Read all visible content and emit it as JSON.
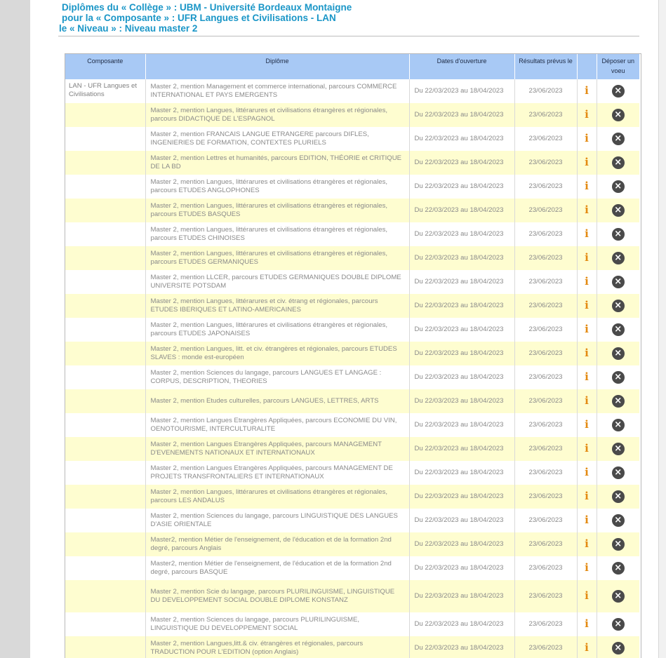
{
  "heading": {
    "line1": "Diplômes du « Collège » : UBM - Université Bordeaux Montaigne",
    "line2": "pour la « Composante » : UFR Langues et Civilisations - LAN",
    "line3": "le « Niveau » : Niveau master 2"
  },
  "table": {
    "headers": {
      "composante": "Composante",
      "diplome": "Diplôme",
      "dates": "Dates d'ouverture",
      "resultats": "Résultats prévus le",
      "info": "",
      "deposer": "Déposer un voeu"
    },
    "composante": "LAN - UFR Langues et Civilisations",
    "info_icon": "info-icon",
    "deposer_icon": "close-circle-icon",
    "rows": [
      {
        "diplome": "Master 2, mention Management et commerce international, parcours COMMERCE INTERNATIONAL ET PAYS EMERGENTS",
        "dates": "Du 22/03/2023 au 18/04/2023",
        "resultats": "23/06/2023"
      },
      {
        "diplome": "Master 2, mention Langues, littérarures et civilisations étrangères et régionales, parcours DIDACTIQUE DE L'ESPAGNOL",
        "dates": "Du 22/03/2023 au 18/04/2023",
        "resultats": "23/06/2023"
      },
      {
        "diplome": "Master 2, mention FRANCAIS LANGUE ETRANGERE parcours DIFLES, INGENIERIES DE FORMATION, CONTEXTES PLURIELS",
        "dates": "Du 22/03/2023 au 18/04/2023",
        "resultats": "23/06/2023"
      },
      {
        "diplome": "Master 2, mention Lettres et humanités, parcours EDITION, THÉORIE et CRITIQUE DE LA BD",
        "dates": "Du 22/03/2023 au 18/04/2023",
        "resultats": "23/06/2023"
      },
      {
        "diplome": "Master 2, mention Langues, littérarures et civilisations étrangères et régionales, parcours ETUDES ANGLOPHONES",
        "dates": "Du 22/03/2023 au 18/04/2023",
        "resultats": "23/06/2023"
      },
      {
        "diplome": "Master 2, mention Langues, littérarures et civilisations étrangères et régionales, parcours ETUDES BASQUES",
        "dates": "Du 22/03/2023 au 18/04/2023",
        "resultats": "23/06/2023"
      },
      {
        "diplome": "Master 2, mention Langues, littérarures et civilisations étrangères et régionales, parcours ETUDES CHINOISES",
        "dates": "Du 22/03/2023 au 18/04/2023",
        "resultats": "23/06/2023"
      },
      {
        "diplome": "Master 2, mention Langues, littérarures et civilisations étrangères et régionales, parcours ETUDES GERMANIQUES",
        "dates": "Du 22/03/2023 au 18/04/2023",
        "resultats": "23/06/2023"
      },
      {
        "diplome": "Master 2, mention LLCER, parcours ETUDES GERMANIQUES DOUBLE DIPLOME UNIVERSITE POTSDAM",
        "dates": "Du 22/03/2023 au 18/04/2023",
        "resultats": "23/06/2023"
      },
      {
        "diplome": "Master 2, mention Langues, littérarures et civ. étrang et régionales, parcours ETUDES IBERIQUES ET LATINO-AMERICAINES",
        "dates": "Du 22/03/2023 au 18/04/2023",
        "resultats": "23/06/2023"
      },
      {
        "diplome": "Master 2, mention Langues, littérarures et civilisations étrangères et régionales, parcours ETUDES JAPONAISES",
        "dates": "Du 22/03/2023 au 18/04/2023",
        "resultats": "23/06/2023"
      },
      {
        "diplome": "Master 2, mention Langues, litt. et civ. étrangères et régionales, parcours ETUDES SLAVES : monde est-européen",
        "dates": "Du 22/03/2023 au 18/04/2023",
        "resultats": "23/06/2023"
      },
      {
        "diplome": "Master 2, mention Sciences du langage, parcours LANGUES ET LANGAGE : CORPUS, DESCRIPTION, THEORIES",
        "dates": "Du 22/03/2023 au 18/04/2023",
        "resultats": "23/06/2023"
      },
      {
        "diplome": "Master 2, mention Etudes culturelles, parcours LANGUES, LETTRES, ARTS",
        "dates": "Du 22/03/2023 au 18/04/2023",
        "resultats": "23/06/2023"
      },
      {
        "diplome": "Master 2, mention Langues Etrangères Appliquées, parcours ECONOMIE DU VIN, OENOTOURISME, INTERCULTURALITE",
        "dates": "Du 22/03/2023 au 18/04/2023",
        "resultats": "23/06/2023"
      },
      {
        "diplome": "Master 2, mention Langues Etrangères Appliquées, parcours MANAGEMENT D'EVENEMENTS NATIONAUX ET INTERNATIONAUX",
        "dates": "Du 22/03/2023 au 18/04/2023",
        "resultats": "23/06/2023"
      },
      {
        "diplome": "Master 2, mention Langues Etrangères Appliquées, parcours MANAGEMENT DE PROJETS TRANSFRONTALIERS ET INTERNATIONAUX",
        "dates": "Du 22/03/2023 au 18/04/2023",
        "resultats": "23/06/2023"
      },
      {
        "diplome": "Master 2, mention Langues, littérarures et civilisations étrangères et régionales, parcours LES ANDALUS",
        "dates": "Du 22/03/2023 au 18/04/2023",
        "resultats": "23/06/2023"
      },
      {
        "diplome": "Master 2, mention Sciences du langage, parcours LINGUISTIQUE DES LANGUES D'ASIE ORIENTALE",
        "dates": "Du 22/03/2023 au 18/04/2023",
        "resultats": "23/06/2023"
      },
      {
        "diplome": "Master2, mention Métier de l'enseignement, de l'éducation et de la formation 2nd degré, parcours Anglais",
        "dates": "Du 22/03/2023 au 18/04/2023",
        "resultats": "23/06/2023"
      },
      {
        "diplome": "Master2, mention Métier de l'enseignement, de l'éducation et de la formation 2nd degré, parcours BASQUE",
        "dates": "Du 22/03/2023 au 18/04/2023",
        "resultats": "23/06/2023"
      },
      {
        "diplome": "Master 2, mention Scie du langage, parcours PLURILINGUISME, LINGUISTIQUE DU DEVELOPPEMENT SOCIAL DOUBLE DIPLOME KONSTANZ",
        "dates": "Du 22/03/2023 au 18/04/2023",
        "resultats": "23/06/2023",
        "tall": true
      },
      {
        "diplome": "Master 2, mention Sciences du langage, parcours PLURILINGUISME, LINGUISTIQUE DU DEVELOPPEMENT SOCIAL",
        "dates": "Du 22/03/2023 au 18/04/2023",
        "resultats": "23/06/2023"
      },
      {
        "diplome": "Master 2, mention Langues,litt.& civ. étrangères et régionales, parcours TRADUCTION POUR L'EDITION (option Anglais)",
        "dates": "Du 22/03/2023 au 18/04/2023",
        "resultats": "23/06/2023"
      }
    ]
  }
}
